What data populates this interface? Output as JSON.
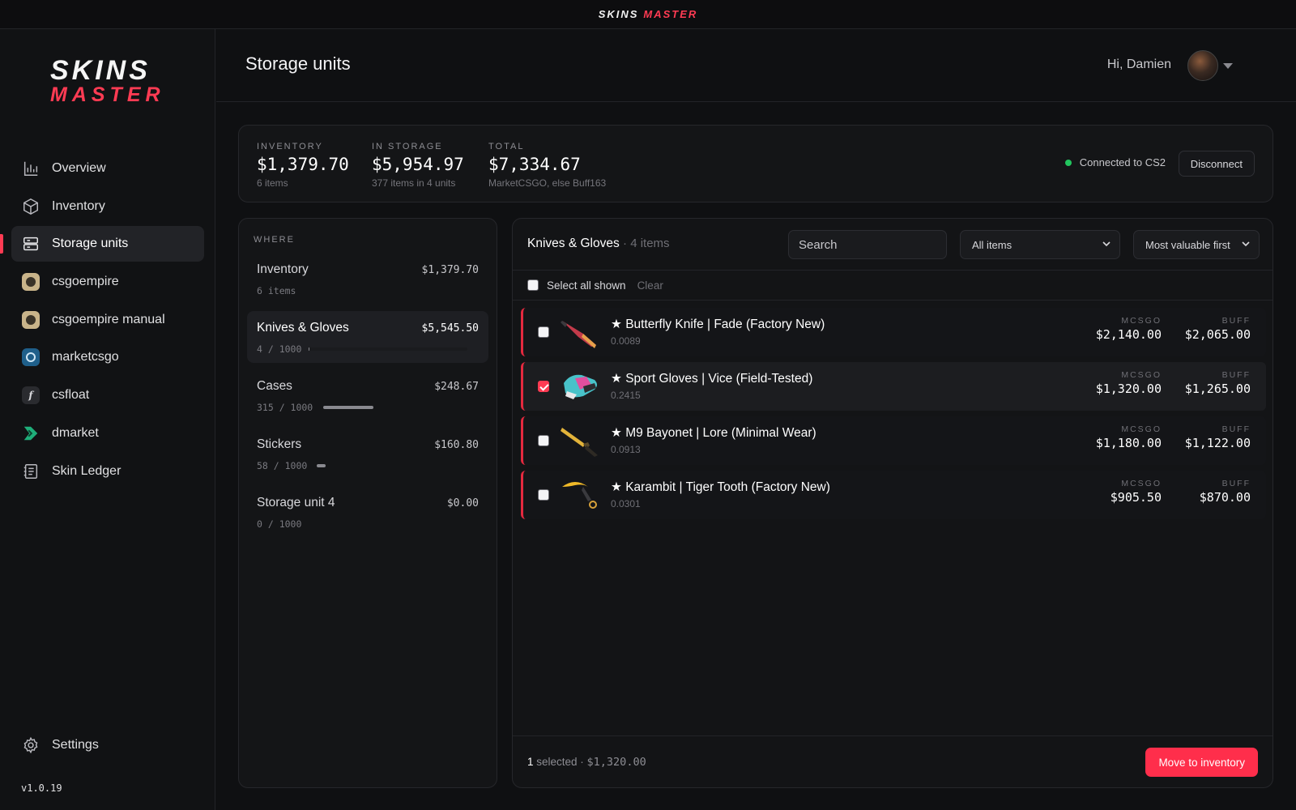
{
  "titlebar": {
    "word1": "SKINS",
    "word2": "MASTER"
  },
  "sidebar": {
    "logo_line1": "SKINS",
    "logo_line2": "MASTER",
    "items": [
      {
        "label": "Overview",
        "icon": "bar-chart-icon",
        "active": false
      },
      {
        "label": "Inventory",
        "icon": "box-icon",
        "active": false
      },
      {
        "label": "Storage units",
        "icon": "storage-icon",
        "active": true
      },
      {
        "label": "csgoempire",
        "icon": "csgoempire-icon",
        "active": false
      },
      {
        "label": "csgoempire manual",
        "icon": "csgoempire-icon",
        "active": false
      },
      {
        "label": "marketcsgo",
        "icon": "marketcsgo-icon",
        "active": false
      },
      {
        "label": "csfloat",
        "icon": "csfloat-icon",
        "active": false
      },
      {
        "label": "dmarket",
        "icon": "dmarket-icon",
        "active": false
      },
      {
        "label": "Skin Ledger",
        "icon": "ledger-icon",
        "active": false
      }
    ],
    "settings_label": "Settings",
    "version": "v1.0.19"
  },
  "header": {
    "title": "Storage units",
    "greeting": "Hi, Damien"
  },
  "stats": {
    "inventory": {
      "label": "INVENTORY",
      "value": "$1,379.70",
      "sub": "6 items"
    },
    "storage": {
      "label": "IN STORAGE",
      "value": "$5,954.97",
      "sub": "377 items in 4 units"
    },
    "total": {
      "label": "TOTAL",
      "value": "$7,334.67",
      "sub": "MarketCSGO, else Buff163"
    },
    "connection": "Connected to CS2",
    "disconnect_label": "Disconnect"
  },
  "where": {
    "label": "WHERE",
    "units": [
      {
        "name": "Inventory",
        "value": "$1,379.70",
        "count": "6 items",
        "fill": null,
        "active": false
      },
      {
        "name": "Knives & Gloves",
        "value": "$5,545.50",
        "count": "4 / 1000",
        "fill": 0.004,
        "active": true
      },
      {
        "name": "Cases",
        "value": "$248.67",
        "count": "315 / 1000",
        "fill": 0.315,
        "active": false
      },
      {
        "name": "Stickers",
        "value": "$160.80",
        "count": "58 / 1000",
        "fill": 0.058,
        "active": false
      },
      {
        "name": "Storage unit 4",
        "value": "$0.00",
        "count": "0 / 1000",
        "fill": 0,
        "active": false
      }
    ]
  },
  "items_panel": {
    "title": "Knives & Gloves",
    "count": "4 items",
    "search_placeholder": "Search",
    "filter": "All items",
    "sort": "Most valuable first",
    "select_all": "Select all shown",
    "clear": "Clear",
    "col_mcsgo": "MCSGO",
    "col_buff": "BUFF",
    "rows": [
      {
        "name": "★ Butterfly Knife | Fade (Factory New)",
        "float": "0.0089",
        "mcsgo": "$2,140.00",
        "buff": "$2,065.00",
        "checked": false,
        "icon": "butterfly-knife-icon"
      },
      {
        "name": "★ Sport Gloves | Vice (Field-Tested)",
        "float": "0.2415",
        "mcsgo": "$1,320.00",
        "buff": "$1,265.00",
        "checked": true,
        "icon": "sport-gloves-icon"
      },
      {
        "name": "★ M9 Bayonet | Lore (Minimal Wear)",
        "float": "0.0913",
        "mcsgo": "$1,180.00",
        "buff": "$1,122.00",
        "checked": false,
        "icon": "m9-bayonet-icon"
      },
      {
        "name": "★ Karambit | Tiger Tooth (Factory New)",
        "float": "0.0301",
        "mcsgo": "$905.50",
        "buff": "$870.00",
        "checked": false,
        "icon": "karambit-icon"
      }
    ],
    "footer_count": "1",
    "footer_text": " selected · ",
    "footer_value": "$1,320.00",
    "action_label": "Move to inventory"
  },
  "colors": {
    "accent": "#ff3b53",
    "connected": "#22c55e",
    "background": "#0f1012"
  }
}
